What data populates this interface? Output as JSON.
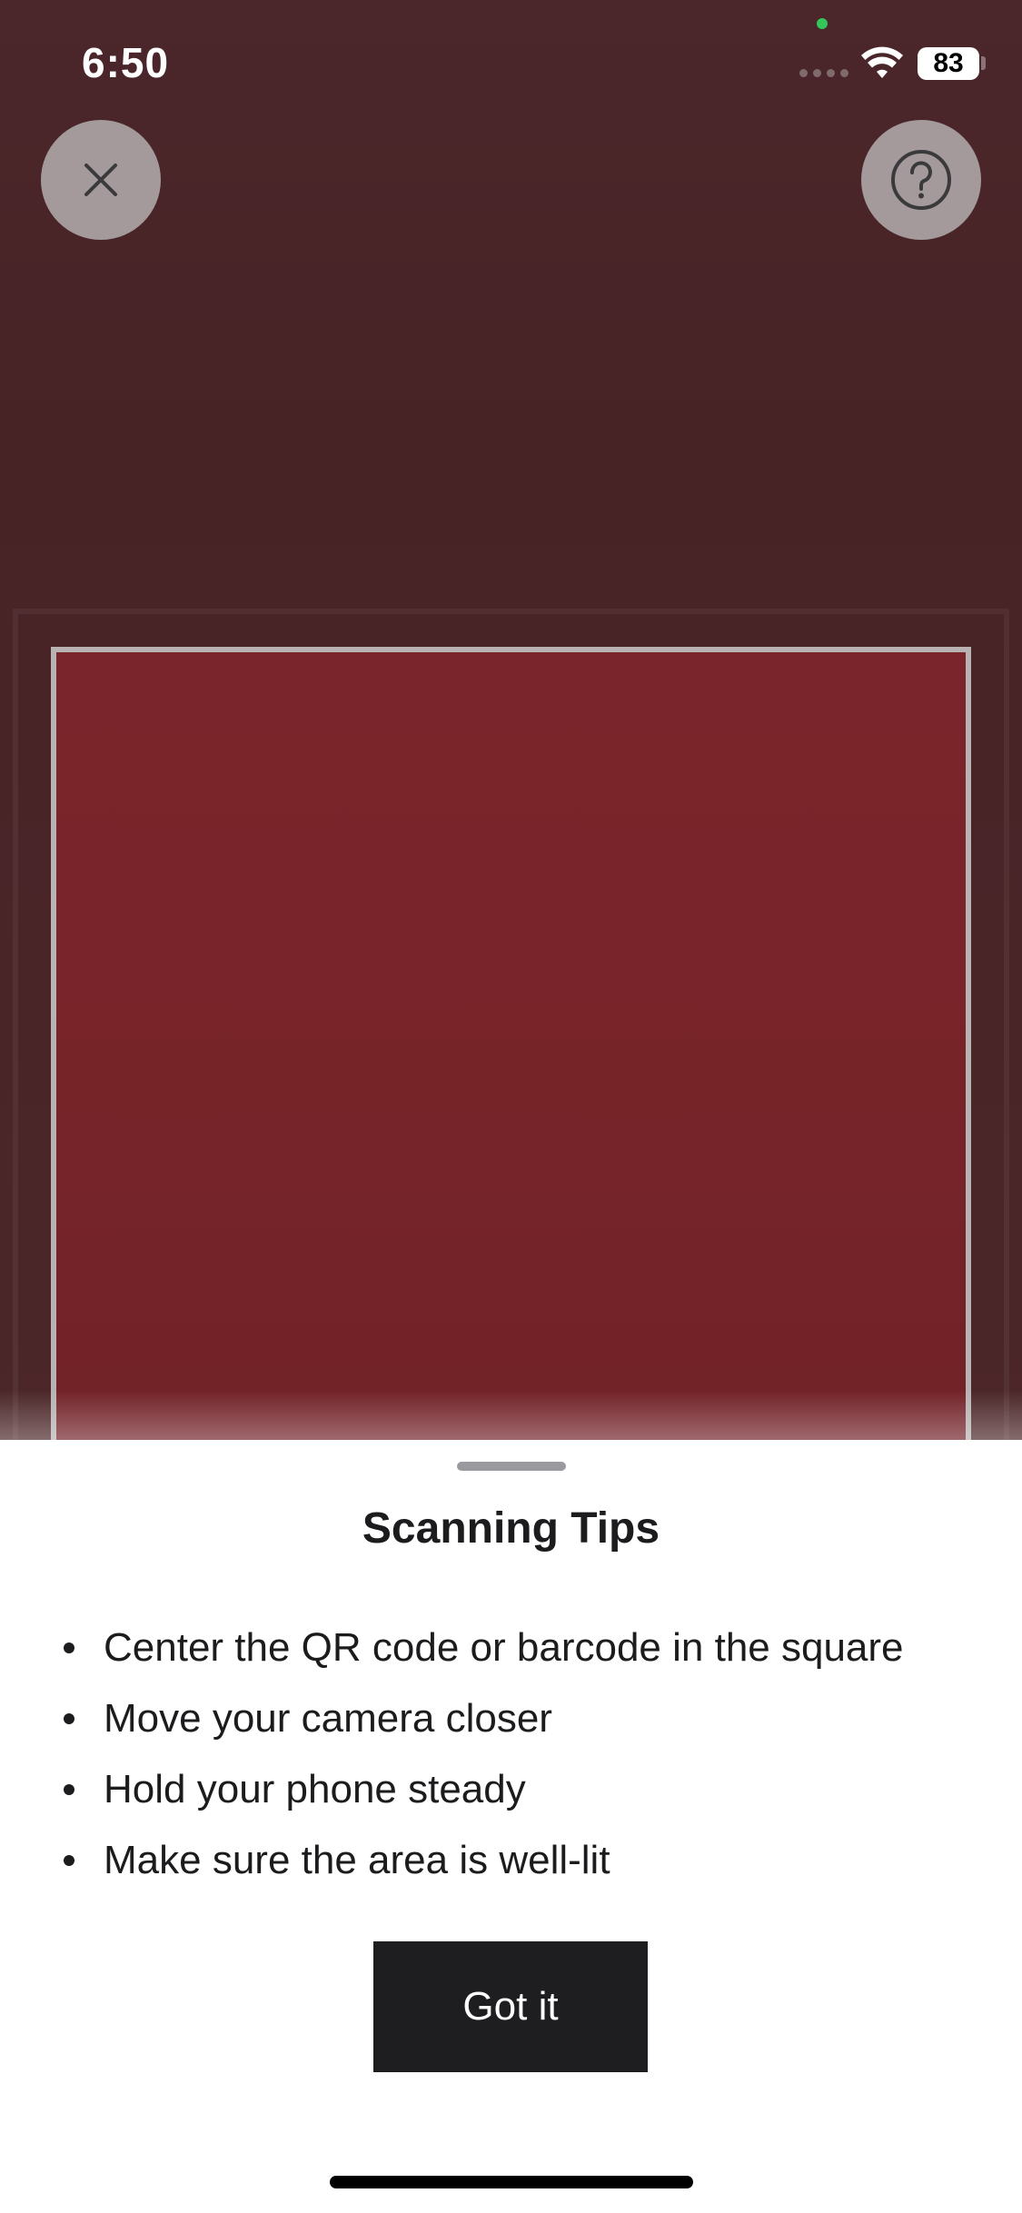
{
  "status_bar": {
    "time": "6:50",
    "battery_level": "83",
    "icons": [
      "signal-dots-icon",
      "wifi-icon",
      "battery-icon"
    ]
  },
  "toolbar": {
    "close_icon": "close-icon",
    "help_icon": "question-circle-icon"
  },
  "sheet": {
    "title": "Scanning Tips",
    "tips": [
      "Center the QR code or barcode in the square",
      "Move your camera closer",
      "Hold your phone steady",
      "Make sure the area is well-lit"
    ],
    "button_label": "Got it"
  },
  "colors": {
    "background": "#4a272b",
    "scan_area": "#772429",
    "frame": "#b8b2b2",
    "button": "#1e1e20",
    "sheet": "#ffffff"
  }
}
